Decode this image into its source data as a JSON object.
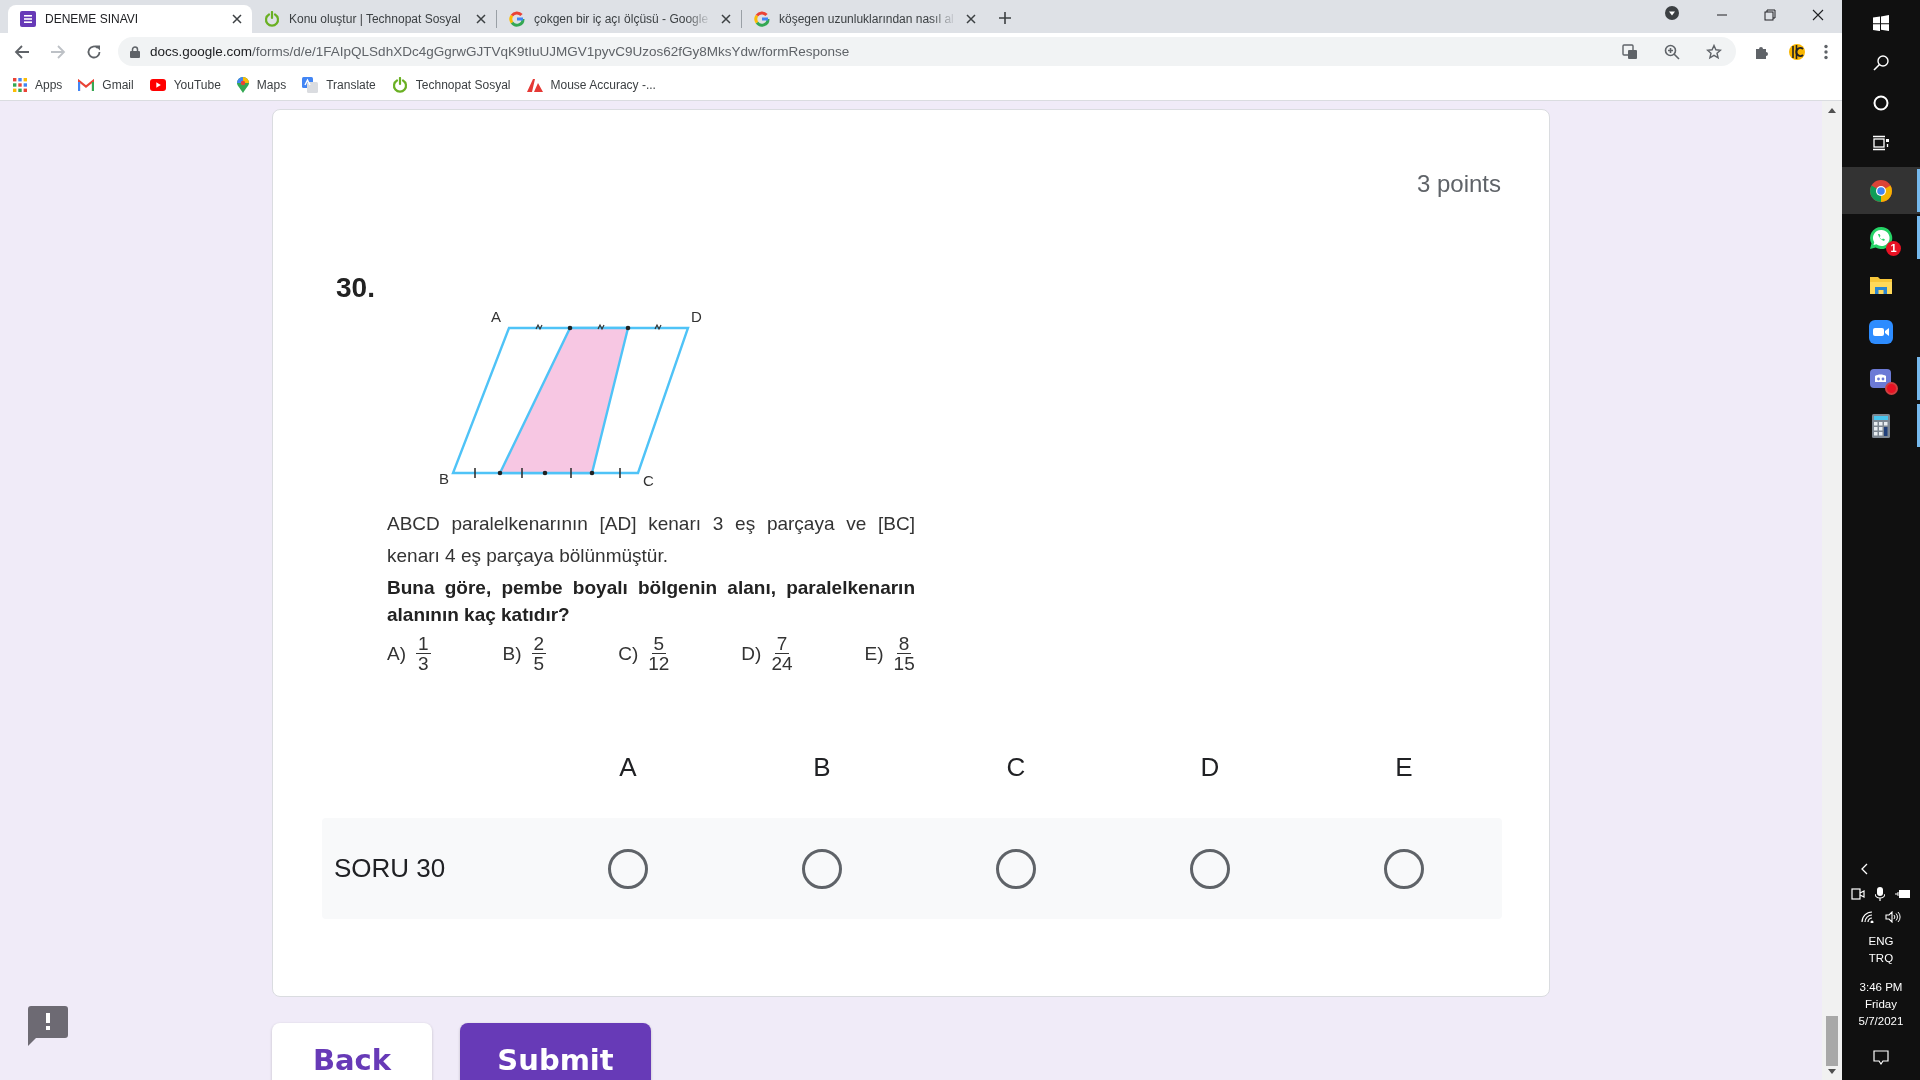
{
  "browser": {
    "tabs": [
      {
        "title": "DENEME SINAVI",
        "kind": "forms",
        "selected": true,
        "faded": false
      },
      {
        "title": "Konu oluştur | Technopat Sosyal",
        "kind": "power",
        "selected": false,
        "faded": false
      },
      {
        "title": "çokgen bir iç açı ölçüsü - Google",
        "kind": "google",
        "selected": false,
        "faded": true
      },
      {
        "title": "köşegen uzunluklarından nasıl al",
        "kind": "google",
        "selected": false,
        "faded": true
      }
    ],
    "url": {
      "host": "docs.google.com",
      "path": "/forms/d/e/1FAIpQLSdhXDc4gGgrwGJTVqK9tIuUJMGV1pyvC9Uzos62fGy8MksYdw/formResponse"
    },
    "bookmarks": [
      {
        "label": "Apps",
        "kind": "apps"
      },
      {
        "label": "Gmail",
        "kind": "gmail"
      },
      {
        "label": "YouTube",
        "kind": "youtube"
      },
      {
        "label": "Maps",
        "kind": "maps"
      },
      {
        "label": "Translate",
        "kind": "translate"
      },
      {
        "label": "Technopat Sosyal",
        "kind": "power"
      },
      {
        "label": "Mouse Accuracy -...",
        "kind": "peak"
      }
    ]
  },
  "form": {
    "points": "3 points",
    "number": "30.",
    "figure": {
      "vertices": [
        "A",
        "D",
        "B",
        "C"
      ]
    },
    "statement": "ABCD paralelkenarının [AD] kenarı 3 eş parçaya ve [BC] kenarı 4 eş parçaya bölünmüştür.",
    "prompt": "Buna göre, pembe boyalı bölgenin alanı, paralelkenarın alanının kaç katıdır?",
    "choices": [
      {
        "letter": "A)",
        "numerator": "1",
        "denominator": "3"
      },
      {
        "letter": "B)",
        "numerator": "2",
        "denominator": "5"
      },
      {
        "letter": "C)",
        "numerator": "5",
        "denominator": "12"
      },
      {
        "letter": "D)",
        "numerator": "7",
        "denominator": "24"
      },
      {
        "letter": "E)",
        "numerator": "8",
        "denominator": "15"
      }
    ],
    "grid": {
      "columns": [
        "A",
        "B",
        "C",
        "D",
        "E"
      ],
      "rows": [
        {
          "label": "SORU 30",
          "options": [
            {
              "selected": false
            },
            {
              "selected": false
            },
            {
              "selected": false
            },
            {
              "selected": false
            },
            {
              "selected": false
            }
          ]
        }
      ]
    },
    "buttons": [
      {
        "label": "Back",
        "kind": "secondary"
      },
      {
        "label": "Submit",
        "kind": "primary"
      }
    ]
  },
  "taskbar": {
    "system": [
      {
        "kind": "windows"
      },
      {
        "kind": "search"
      },
      {
        "kind": "cortana"
      },
      {
        "kind": "taskview"
      }
    ],
    "apps": [
      {
        "kind": "chrome",
        "selected": true,
        "running": true,
        "alert": false
      },
      {
        "kind": "whatsapp",
        "selected": false,
        "running": true,
        "alert": false,
        "badge": "1"
      },
      {
        "kind": "explorer",
        "selected": false,
        "running": false,
        "alert": false
      },
      {
        "kind": "zoom",
        "selected": false,
        "running": false,
        "alert": false
      },
      {
        "kind": "discord",
        "selected": false,
        "running": true,
        "alert": true
      },
      {
        "kind": "calculator",
        "selected": false,
        "running": true,
        "alert": false
      }
    ],
    "language": [
      "ENG",
      "TRQ"
    ],
    "clock": [
      "3:46 PM",
      "Friday",
      "5/7/2021"
    ]
  }
}
